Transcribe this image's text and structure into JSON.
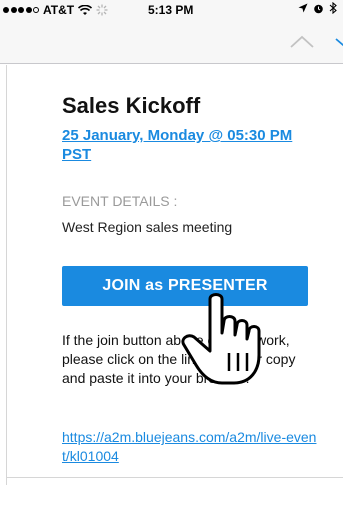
{
  "status_bar": {
    "carrier": "AT&T",
    "time": "5:13 PM"
  },
  "email": {
    "title": "Sales Kickoff",
    "date_line": "25 January, Monday @ 05:30 PM PST",
    "section_label": "EVENT DETAILS :",
    "description": "West Region sales meeting",
    "join_button_label": "JOIN as PRESENTER",
    "help_text": "If the join button above doesn't work, please click on the link below, or copy and paste it into your browser:",
    "event_link": "https://a2m.bluejeans.com/a2m/live-event/kl01004"
  },
  "colors": {
    "accent": "#1a8ae0",
    "muted_text": "#9a9a9a",
    "bar_background": "#f7f7f7"
  },
  "icons": [
    "wifi-icon",
    "loading-icon",
    "location-arrow-icon",
    "alarm-icon",
    "bluetooth-icon",
    "chevron-up-icon",
    "chevron-down-icon",
    "hand-pointer-icon"
  ]
}
